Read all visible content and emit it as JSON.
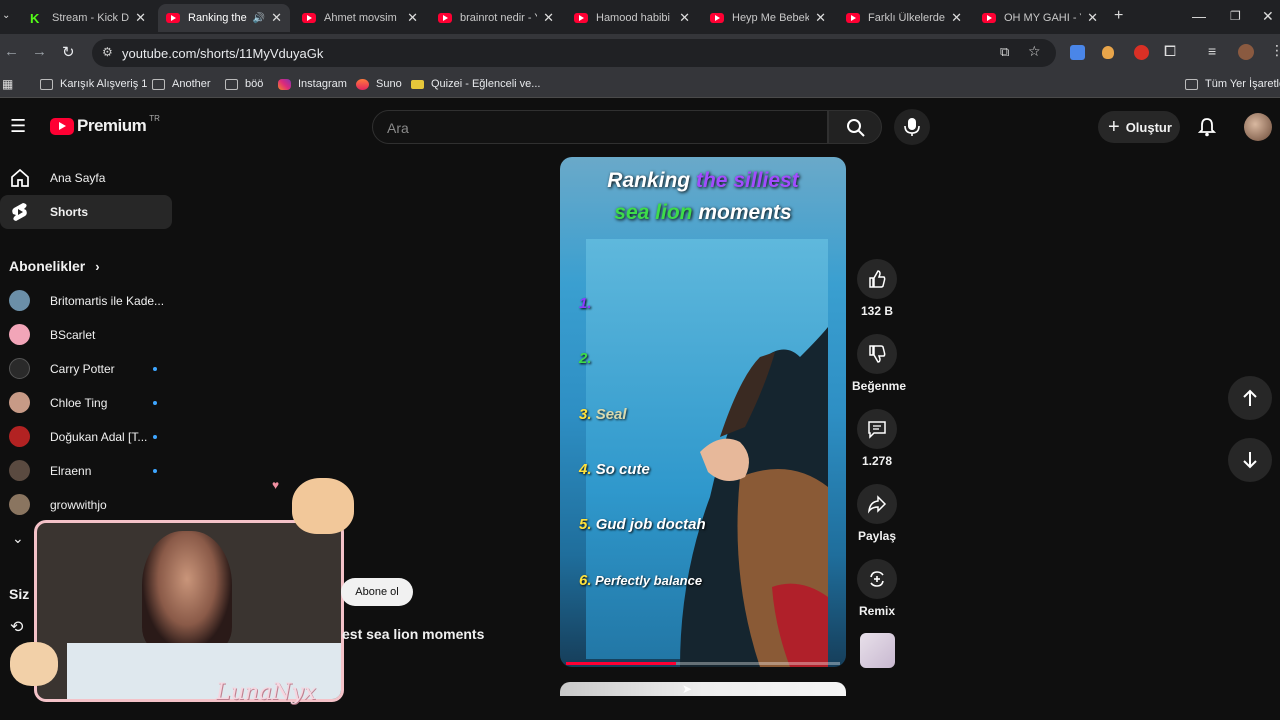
{
  "browser": {
    "tabs": [
      {
        "title": "Stream - Kick Da",
        "favicon": "kick-icon"
      },
      {
        "title": "Ranking the",
        "favicon": "youtube-icon",
        "active": true
      },
      {
        "title": "Ahmet movsim",
        "favicon": "youtube-icon"
      },
      {
        "title": "brainrot nedir - Y",
        "favicon": "youtube-icon"
      },
      {
        "title": "Hamood habibi",
        "favicon": "youtube-icon"
      },
      {
        "title": "Heyp Me Bebek",
        "favicon": "youtube-icon"
      },
      {
        "title": "Farklı Ülkelerden",
        "favicon": "youtube-icon"
      },
      {
        "title": "OH MY GAHI - Y",
        "favicon": "youtube-icon"
      }
    ],
    "url": "youtube.com/shorts/11MyVduyaGk",
    "bookmarks": [
      {
        "label": "Karışık Alışveriş 1"
      },
      {
        "label": "Another"
      },
      {
        "label": "böö"
      },
      {
        "label": "Instagram"
      },
      {
        "label": "Suno"
      },
      {
        "label": "Quizei - Eğlenceli ve..."
      }
    ],
    "all_bookmarks_label": "Tüm Yer İşaretleri"
  },
  "youtube": {
    "logo_text": "Premium",
    "logo_badge": "TR",
    "search_placeholder": "Ara",
    "create_label": "Oluştur",
    "sidebar": {
      "home": "Ana Sayfa",
      "shorts": "Shorts",
      "subscriptions_heading": "Abonelikler",
      "channels": [
        {
          "name": "Britomartis ile Kade...",
          "new": false,
          "color": "#6b8fa8"
        },
        {
          "name": "BScarlet",
          "new": false,
          "color": "#f2a5b8"
        },
        {
          "name": "Carry Potter",
          "new": true,
          "color": "#2a2a2a"
        },
        {
          "name": "Chloe Ting",
          "new": true,
          "color": "#c79a86"
        },
        {
          "name": "Doğukan Adal [T...",
          "new": true,
          "color": "#b22222"
        },
        {
          "name": "Elraenn",
          "new": true,
          "color": "#5a4a40"
        },
        {
          "name": "growwithjo",
          "new": false,
          "color": "#8a7560"
        }
      ],
      "you_heading": "Siz"
    },
    "short": {
      "title_line1_white": "Ranking",
      "title_line1_purple": "the silliest",
      "title_line2_green": "sea lion",
      "title_line2_white": "moments",
      "rankings": [
        {
          "n": "1.",
          "text": "",
          "color": "#8a3cff"
        },
        {
          "n": "2.",
          "text": "",
          "color": "#3ddc4a"
        },
        {
          "n": "3.",
          "text": "Seal",
          "color": "#ffe23d"
        },
        {
          "n": "4.",
          "text": "So cute",
          "color": "#ffe23d"
        },
        {
          "n": "5.",
          "text": "Gud job doctah",
          "color": "#ffe23d"
        },
        {
          "n": "6.",
          "text": "Perfectly balance",
          "color": "#ffe23d"
        }
      ],
      "progress": 0.4,
      "subscribe_label": "Abone ol",
      "caption": "est sea lion moments"
    },
    "actions": {
      "likes": "132 B",
      "dislike": "Beğenme",
      "comments": "1.278",
      "share": "Paylaş",
      "remix": "Remix"
    }
  },
  "overlay": {
    "streamer_name": "LunaNyx"
  }
}
